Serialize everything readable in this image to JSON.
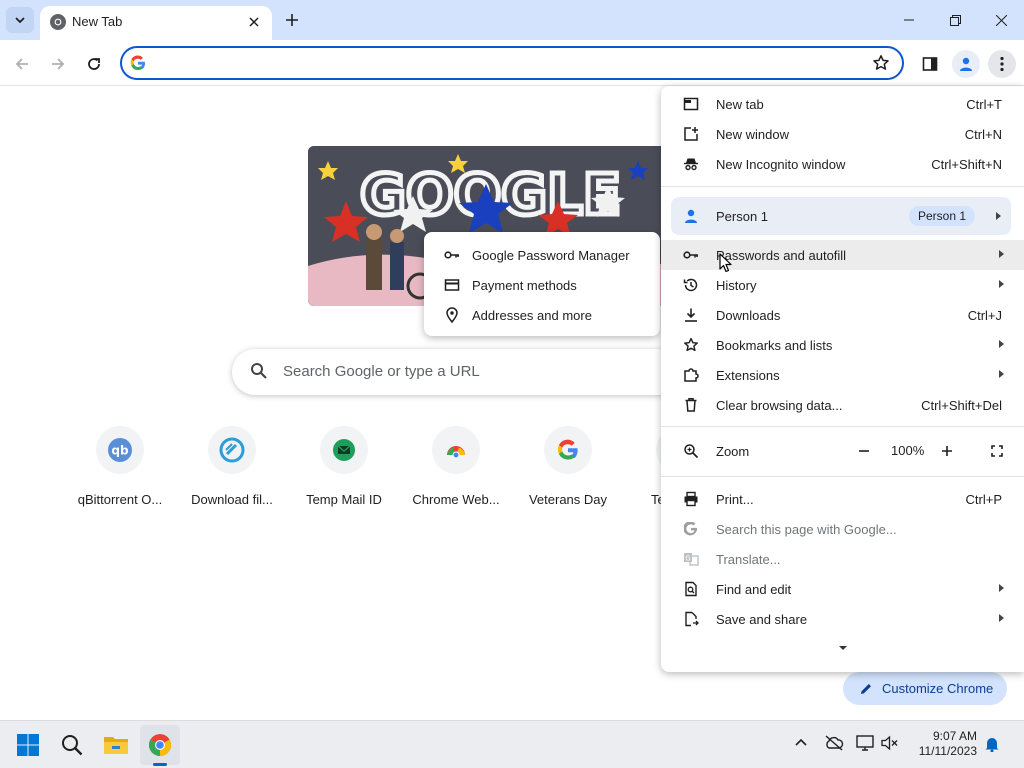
{
  "browser": {
    "tab": {
      "title": "New Tab"
    },
    "omnibox": {
      "value": "",
      "placeholder": ""
    }
  },
  "ntp": {
    "doodle_alt": "GOOGLE",
    "search_placeholder": "Search Google or type a URL",
    "shortcuts": [
      {
        "label": "qBittorrent O...",
        "icon": "qbittorrent-icon"
      },
      {
        "label": "Download fil...",
        "icon": "download-site-icon"
      },
      {
        "label": "Temp Mail ID",
        "icon": "temp-mail-icon"
      },
      {
        "label": "Chrome Web...",
        "icon": "chrome-web-store-icon"
      },
      {
        "label": "Veterans Day",
        "icon": "google-g-icon"
      },
      {
        "label": "Te",
        "icon": "partial-shortcut-icon"
      }
    ],
    "customize_label": "Customize Chrome"
  },
  "menu": {
    "new_tab": {
      "label": "New tab",
      "shortcut": "Ctrl+T"
    },
    "new_window": {
      "label": "New window",
      "shortcut": "Ctrl+N"
    },
    "new_incognito": {
      "label": "New Incognito window",
      "shortcut": "Ctrl+Shift+N"
    },
    "person": {
      "label": "Person 1",
      "badge": "Person 1"
    },
    "passwords": {
      "label": "Passwords and autofill"
    },
    "history": {
      "label": "History"
    },
    "downloads": {
      "label": "Downloads",
      "shortcut": "Ctrl+J"
    },
    "bookmarks": {
      "label": "Bookmarks and lists"
    },
    "extensions": {
      "label": "Extensions"
    },
    "clear_data": {
      "label": "Clear browsing data...",
      "shortcut": "Ctrl+Shift+Del"
    },
    "zoom": {
      "label": "Zoom",
      "value": "100%",
      "minus": "−",
      "plus": "+"
    },
    "print": {
      "label": "Print...",
      "shortcut": "Ctrl+P"
    },
    "search_page": {
      "label": "Search this page with Google..."
    },
    "translate": {
      "label": "Translate..."
    },
    "find_edit": {
      "label": "Find and edit"
    },
    "save_share": {
      "label": "Save and share"
    }
  },
  "submenu": {
    "password_manager": {
      "label": "Google Password Manager"
    },
    "payment_methods": {
      "label": "Payment methods"
    },
    "addresses": {
      "label": "Addresses and more"
    }
  },
  "taskbar": {
    "time": "9:07 AM",
    "date": "11/11/2023"
  },
  "colors": {
    "accent": "#0b57d0",
    "tabstrip": "#d3e3fd",
    "taskbar": "#ecedf0"
  }
}
